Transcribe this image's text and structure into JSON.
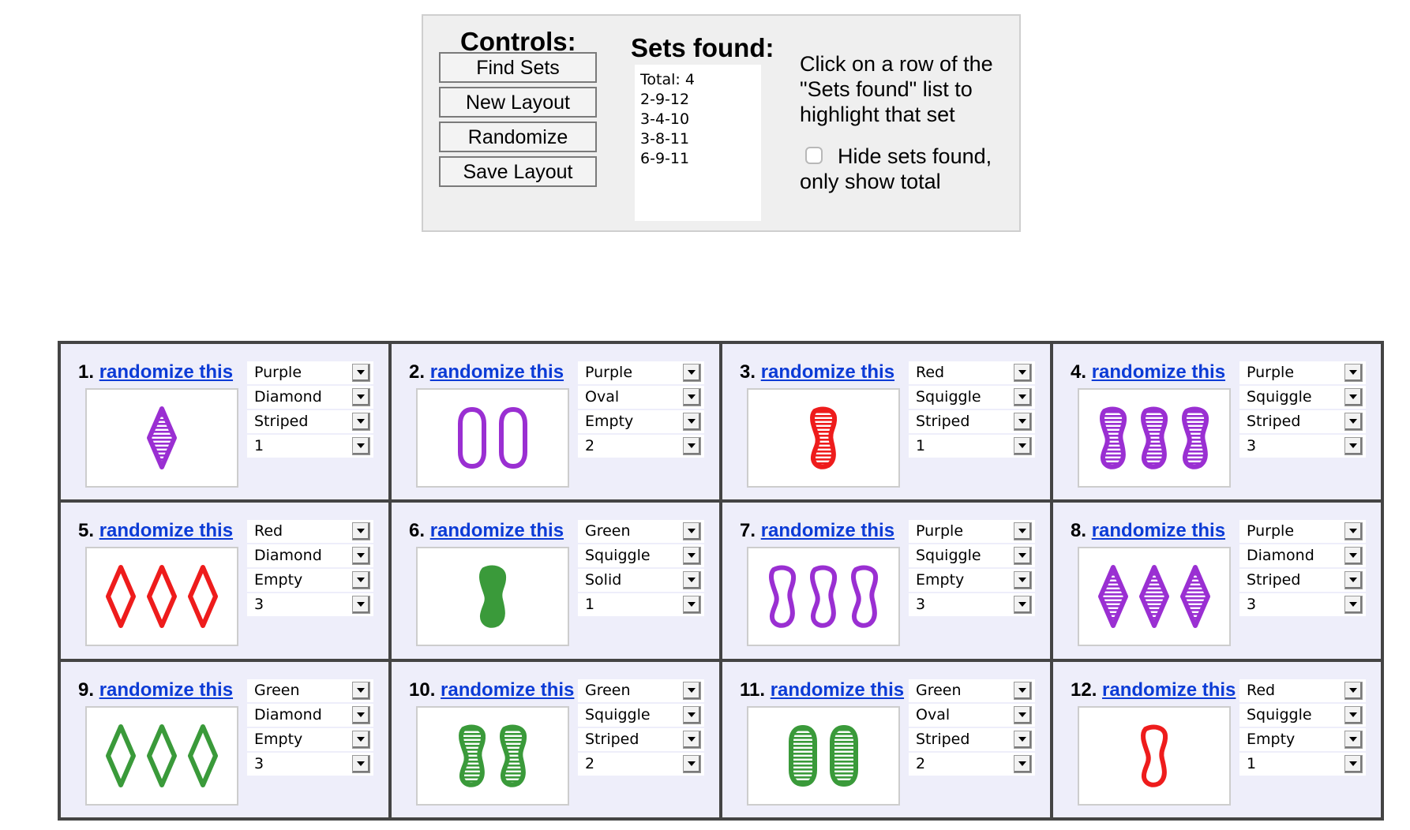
{
  "controls": {
    "title": "Controls:",
    "buttons": [
      "Find Sets",
      "New Layout",
      "Randomize",
      "Save Layout"
    ]
  },
  "sets": {
    "title": "Sets found:",
    "rows": [
      "Total: 4",
      "2-9-12",
      "3-4-10",
      "3-8-11",
      "6-9-11"
    ]
  },
  "help": {
    "text": "Click on a row of the \"Sets found\" list to highlight that set",
    "hide_label": "Hide sets found, only show total",
    "hide_checked": false
  },
  "colors": {
    "Purple": "#9a2fd2",
    "Red": "#ee1c1c",
    "Green": "#3a9a3a"
  },
  "card_link_text": "randomize this",
  "cards": [
    {
      "num": "1.",
      "color": "Purple",
      "shape": "Diamond",
      "fill": "Striped",
      "count": "1"
    },
    {
      "num": "2.",
      "color": "Purple",
      "shape": "Oval",
      "fill": "Empty",
      "count": "2"
    },
    {
      "num": "3.",
      "color": "Red",
      "shape": "Squiggle",
      "fill": "Striped",
      "count": "1"
    },
    {
      "num": "4.",
      "color": "Purple",
      "shape": "Squiggle",
      "fill": "Striped",
      "count": "3"
    },
    {
      "num": "5.",
      "color": "Red",
      "shape": "Diamond",
      "fill": "Empty",
      "count": "3"
    },
    {
      "num": "6.",
      "color": "Green",
      "shape": "Squiggle",
      "fill": "Solid",
      "count": "1"
    },
    {
      "num": "7.",
      "color": "Purple",
      "shape": "Squiggle",
      "fill": "Empty",
      "count": "3"
    },
    {
      "num": "8.",
      "color": "Purple",
      "shape": "Diamond",
      "fill": "Striped",
      "count": "3"
    },
    {
      "num": "9.",
      "color": "Green",
      "shape": "Diamond",
      "fill": "Empty",
      "count": "3"
    },
    {
      "num": "10.",
      "color": "Green",
      "shape": "Squiggle",
      "fill": "Striped",
      "count": "2"
    },
    {
      "num": "11.",
      "color": "Green",
      "shape": "Oval",
      "fill": "Striped",
      "count": "2"
    },
    {
      "num": "12.",
      "color": "Red",
      "shape": "Squiggle",
      "fill": "Empty",
      "count": "1"
    }
  ]
}
